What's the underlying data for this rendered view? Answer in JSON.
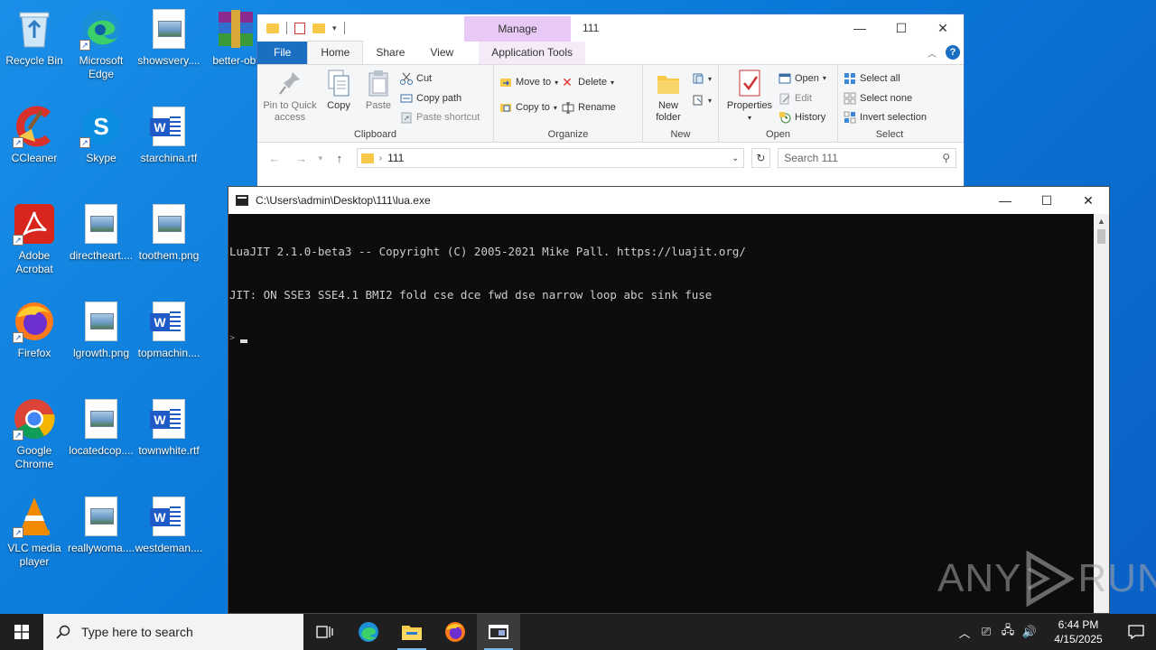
{
  "desktop": {
    "icons": [
      {
        "label": "Recycle Bin",
        "icon": "recycle-bin-icon"
      },
      {
        "label": "Microsoft Edge",
        "icon": "edge-icon"
      },
      {
        "label": "showsvery....",
        "icon": "image-file-icon"
      },
      {
        "label": "better-obf",
        "icon": "winrar-icon"
      },
      {
        "label": "CCleaner",
        "icon": "ccleaner-icon"
      },
      {
        "label": "Skype",
        "icon": "skype-icon"
      },
      {
        "label": "starchina.rtf",
        "icon": "word-doc-icon"
      },
      {
        "label": "Adobe Acrobat",
        "icon": "acrobat-icon"
      },
      {
        "label": "directheart....",
        "icon": "image-file-icon"
      },
      {
        "label": "toothem.png",
        "icon": "image-file-icon"
      },
      {
        "label": "Firefox",
        "icon": "firefox-icon"
      },
      {
        "label": "lgrowth.png",
        "icon": "image-file-icon"
      },
      {
        "label": "topmachin....",
        "icon": "word-doc-icon"
      },
      {
        "label": "Google Chrome",
        "icon": "chrome-icon"
      },
      {
        "label": "locatedcop....",
        "icon": "image-file-icon"
      },
      {
        "label": "townwhite.rtf",
        "icon": "word-doc-icon"
      },
      {
        "label": "VLC media player",
        "icon": "vlc-icon"
      },
      {
        "label": "reallywoma....",
        "icon": "image-file-icon"
      },
      {
        "label": "westdeman....",
        "icon": "word-doc-icon"
      }
    ]
  },
  "explorer": {
    "manage_label": "Manage",
    "title": "111",
    "tabs": {
      "file": "File",
      "home": "Home",
      "share": "Share",
      "view": "View",
      "app_tools": "Application Tools"
    },
    "ribbon": {
      "clipboard": {
        "group": "Clipboard",
        "pin": "Pin to Quick access",
        "copy": "Copy",
        "paste": "Paste",
        "cut": "Cut",
        "copy_path": "Copy path",
        "paste_shortcut": "Paste shortcut"
      },
      "organize": {
        "group": "Organize",
        "move_to": "Move to",
        "copy_to": "Copy to",
        "delete": "Delete",
        "rename": "Rename"
      },
      "new": {
        "group": "New",
        "new_folder": "New folder"
      },
      "open": {
        "group": "Open",
        "properties": "Properties",
        "open": "Open",
        "edit": "Edit",
        "history": "History"
      },
      "select": {
        "group": "Select",
        "select_all": "Select all",
        "select_none": "Select none",
        "invert": "Invert selection"
      }
    },
    "address": {
      "path": "111",
      "search_placeholder": "Search 111"
    }
  },
  "console": {
    "title": "C:\\Users\\admin\\Desktop\\111\\lua.exe",
    "lines": [
      "LuaJIT 2.1.0-beta3 -- Copyright (C) 2005-2021 Mike Pall. https://luajit.org/",
      "JIT: ON SSE3 SSE4.1 BMI2 fold cse dce fwd dse narrow loop abc sink fuse"
    ],
    "prompt": ">"
  },
  "watermark": {
    "left": "ANY",
    "right": "RUN"
  },
  "taskbar": {
    "search_placeholder": "Type here to search",
    "time": "6:44 PM",
    "date": "4/15/2025"
  }
}
